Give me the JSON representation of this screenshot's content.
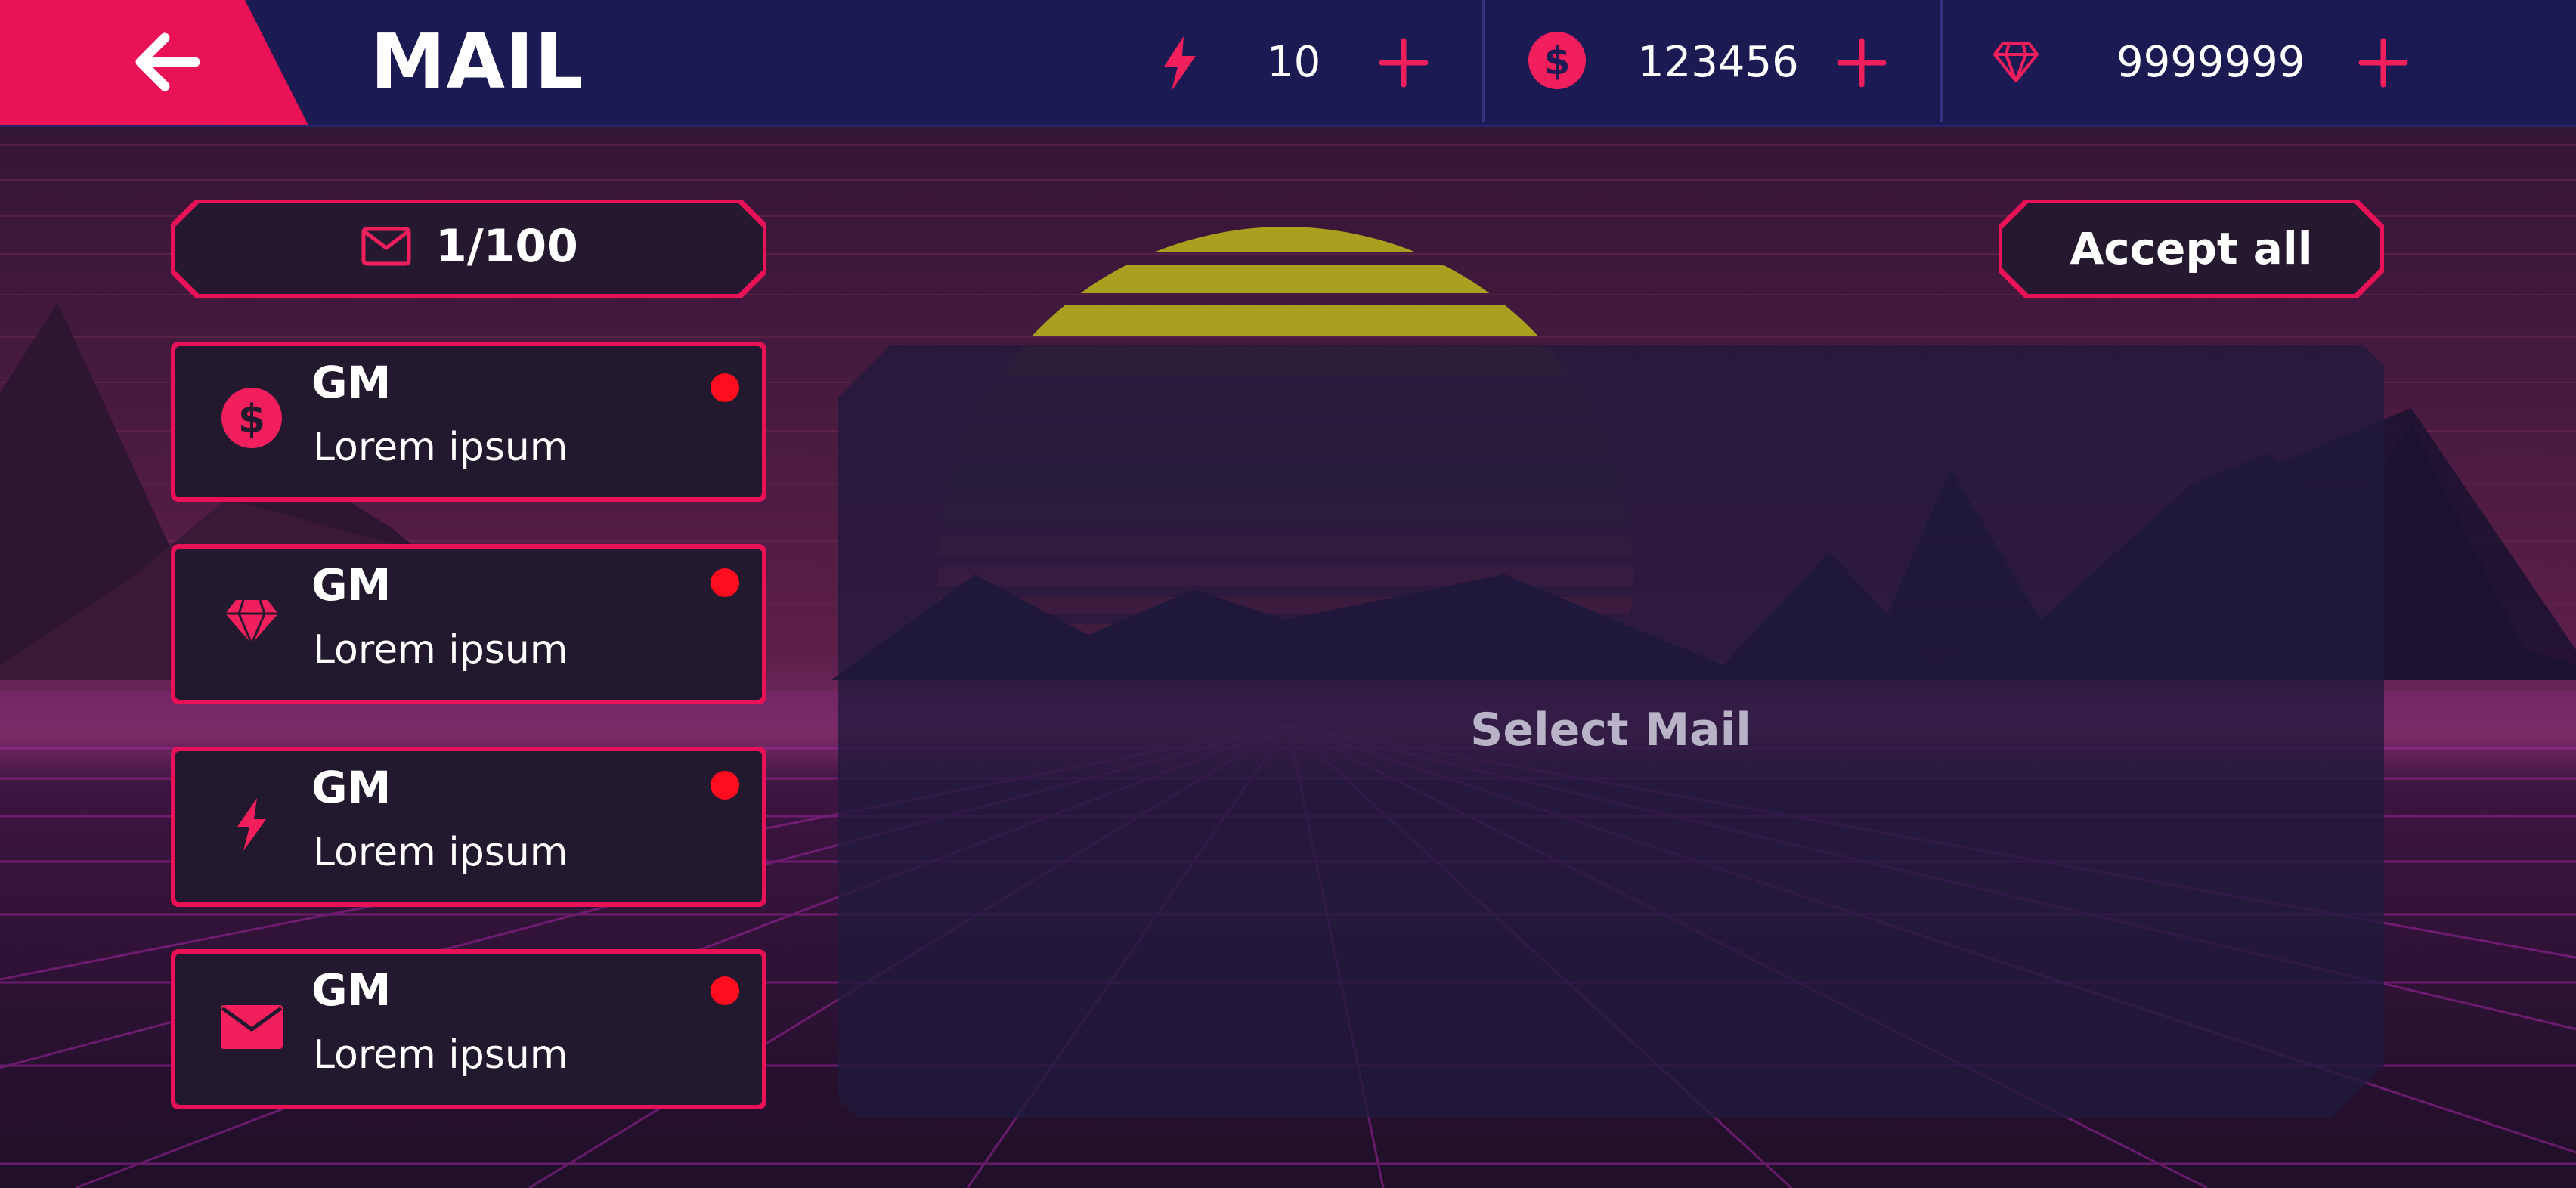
{
  "header": {
    "back_icon": "arrow-left-icon",
    "title": "MAIL"
  },
  "resources": [
    {
      "icon": "lightning-icon",
      "value": "10",
      "plus_icon": "plus-icon"
    },
    {
      "icon": "dollar-coin-icon",
      "value": "123456",
      "plus_icon": "plus-icon"
    },
    {
      "icon": "diamond-icon",
      "value": "9999999",
      "plus_icon": "plus-icon"
    }
  ],
  "mailbox": {
    "icon": "envelope-outline-icon",
    "count": "1/100"
  },
  "mails": [
    {
      "icon": "dollar-coin-icon",
      "sender": "GM",
      "subject": "Lorem ipsum",
      "unread": true
    },
    {
      "icon": "diamond-icon",
      "sender": "GM",
      "subject": "Lorem ipsum",
      "unread": true
    },
    {
      "icon": "lightning-icon",
      "sender": "GM",
      "subject": "Lorem ipsum",
      "unread": true
    },
    {
      "icon": "envelope-icon",
      "sender": "GM",
      "subject": "Lorem ipsum",
      "unread": true
    }
  ],
  "actions": {
    "accept_all_label": "Accept all"
  },
  "detail": {
    "empty_text": "Select Mail"
  },
  "colors": {
    "accent": "#ea1256",
    "topbar": "#1b1a52",
    "unread_dot": "#ff0d1e",
    "sun": "#a9a020"
  }
}
